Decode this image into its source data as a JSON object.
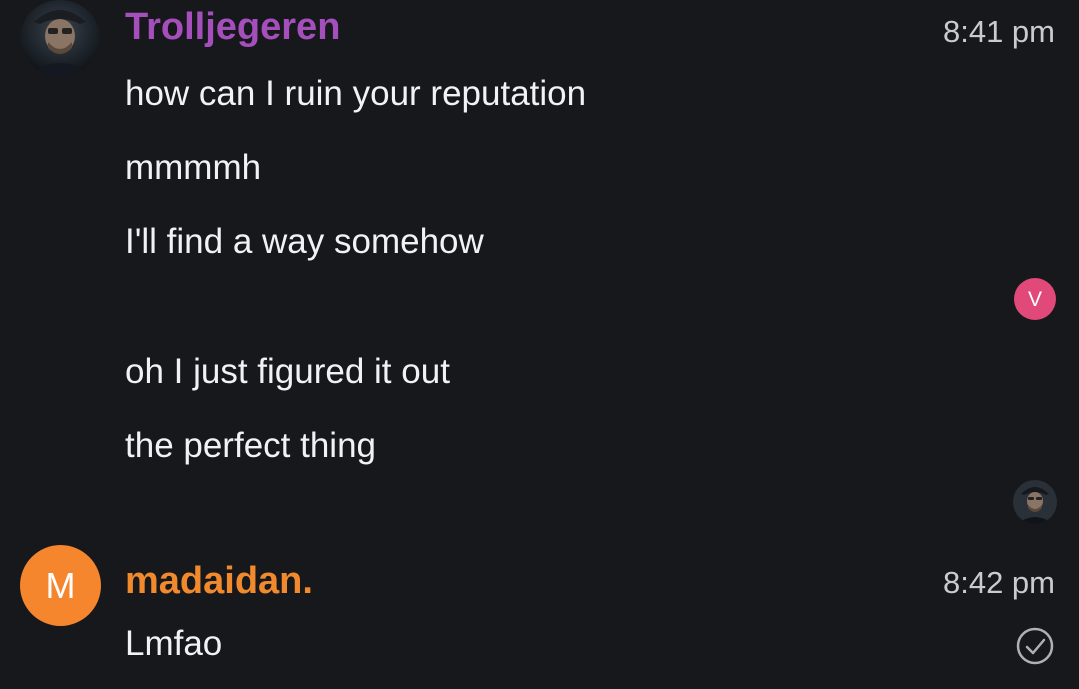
{
  "messages": [
    {
      "author": "Trolljegeren",
      "author_color": "#a54fbd",
      "time": "8:41 pm",
      "lines": [
        "how can I ruin your reputation",
        "mmmmh",
        "I'll find a way somehow",
        "oh I just figured it out",
        "the perfect thing"
      ]
    },
    {
      "author": "madaidan.",
      "author_color": "#f08a2c",
      "avatar_letter": "M",
      "avatar_color": "#f5862e",
      "time": "8:42 pm",
      "lines": [
        "Lmfao"
      ]
    }
  ],
  "read_receipts": {
    "letter": "V",
    "letter_color": "#e0497a"
  },
  "colors": {
    "background": "#17181c",
    "text": "#f1f2f4",
    "timestamp": "#c9cbd0"
  },
  "icons": {
    "status": "check-circle-icon"
  }
}
